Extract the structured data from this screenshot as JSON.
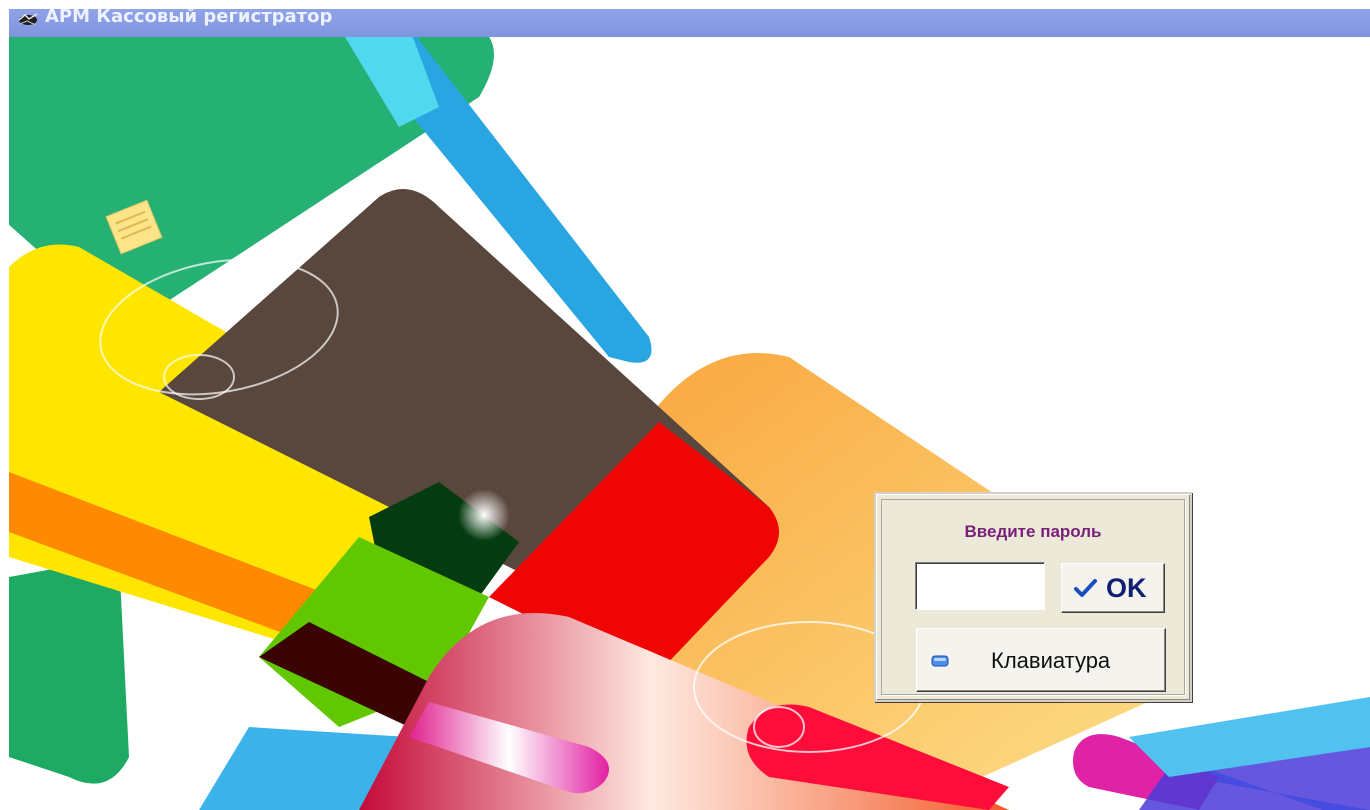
{
  "window": {
    "title": "АРМ Кассовый регистратор",
    "app_icon": "app-logo-icon"
  },
  "dialog": {
    "title": "Введите пароль",
    "password_value": "",
    "ok_label": "OK",
    "ok_icon": "checkmark-icon",
    "keyboard_label": "Клавиатура",
    "keyboard_icon": "keyboard-icon"
  },
  "colors": {
    "titlebar": "#8fa3e8",
    "dialog_bg": "#ece9d8",
    "dialog_title": "#7a1f7a",
    "ok_text": "#0f1f72"
  }
}
